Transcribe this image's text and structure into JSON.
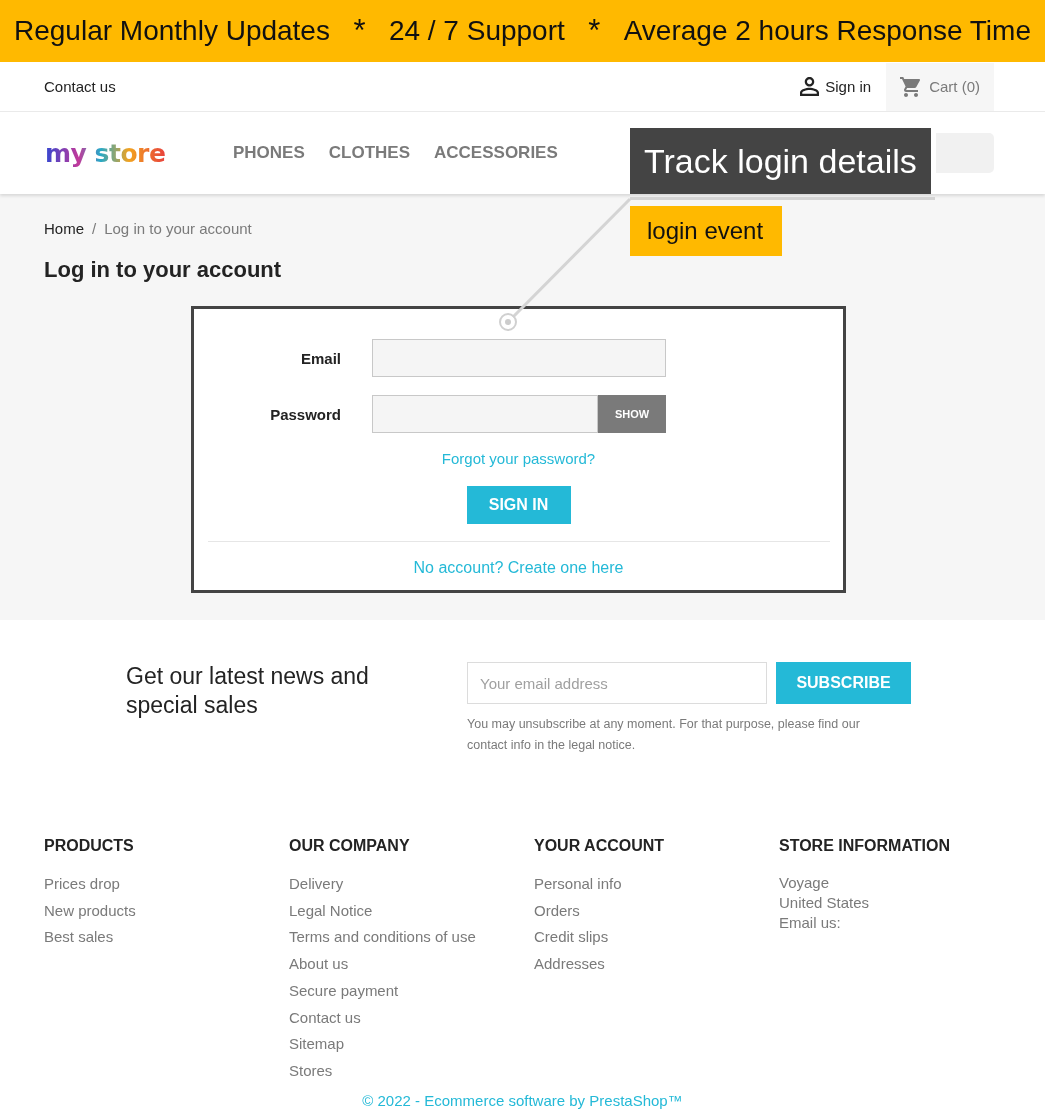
{
  "banner": [
    {
      "kind": "text",
      "text": "Regular Monthly Updates"
    },
    {
      "kind": "separator",
      "text": "*"
    },
    {
      "kind": "text",
      "text": "24 / 7 Support"
    },
    {
      "kind": "separator",
      "text": "*"
    },
    {
      "kind": "text",
      "text": "Average 2 hours Response Time"
    }
  ],
  "top_bar": {
    "contact_link": "Contact us",
    "sign_in": "Sign in",
    "cart": "Cart (0)"
  },
  "header": {
    "logo": "my store",
    "menu": [
      "PHONES",
      "CLOTHES",
      "ACCESSORIES"
    ]
  },
  "annotation": {
    "callout": "Track login details",
    "tag": "login event"
  },
  "breadcrumb": {
    "separator": "/",
    "items": [
      {
        "text": "Home",
        "current": false
      },
      {
        "text": "Log in to your account",
        "current": true
      }
    ]
  },
  "page_title": "Log in to your account",
  "login_form": {
    "fields": [
      {
        "kind": "email",
        "label": "Email"
      },
      {
        "kind": "password",
        "label": "Password",
        "toggle": "SHOW"
      }
    ],
    "forgot_link": "Forgot your password?",
    "submit": "SIGN IN",
    "create_account": "No account? Create one here"
  },
  "newsletter": {
    "heading": "Get our latest news and special sales",
    "placeholder": "Your email address",
    "button": "SUBSCRIBE",
    "note": "You may unsubscribe at any moment. For that purpose, please find our contact info in the legal notice."
  },
  "footer": {
    "columns": [
      {
        "kind": "links",
        "title": "PRODUCTS",
        "items": [
          "Prices drop",
          "New products",
          "Best sales"
        ]
      },
      {
        "kind": "links",
        "title": "OUR COMPANY",
        "items": [
          "Delivery",
          "Legal Notice",
          "Terms and conditions of use",
          "About us",
          "Secure payment",
          "Contact us",
          "Sitemap",
          "Stores"
        ]
      },
      {
        "kind": "links",
        "title": "YOUR ACCOUNT",
        "items": [
          "Personal info",
          "Orders",
          "Credit slips",
          "Addresses"
        ]
      },
      {
        "kind": "info",
        "title": "STORE INFORMATION",
        "items": [
          "Voyage",
          "United States",
          "Email us:"
        ]
      }
    ],
    "copyright": "© 2022 - Ecommerce software by PrestaShop™"
  }
}
